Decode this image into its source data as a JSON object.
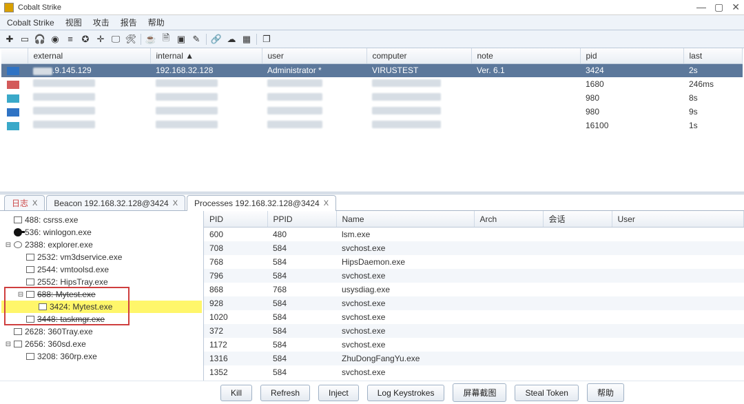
{
  "app_title": "Cobalt Strike",
  "menu": [
    "Cobalt Strike",
    "视图",
    "攻击",
    "报告",
    "帮助"
  ],
  "toolbar_icons": [
    "plus-box-icon",
    "minus-box-icon",
    "headphones-icon",
    "radar-icon",
    "list-lines-icon",
    "target-icon",
    "crosshair-icon",
    "monitor-icon",
    "tools-icon",
    "sep",
    "coffee-icon",
    "document-icon",
    "save-icon",
    "pen-icon",
    "sep",
    "link-icon",
    "cloud-icon",
    "grid-icon",
    "sep",
    "cube-icon"
  ],
  "columns": {
    "external": "external",
    "internal": "internal ▲",
    "user": "user",
    "computer": "computer",
    "note": "note",
    "pid": "pid",
    "last": "last"
  },
  "beacons": [
    {
      "icon": "var1",
      "external": ".9.145.129",
      "internal": "192.168.32.128",
      "user": "Administrator *",
      "computer": "VIRUSTEST",
      "note": "Ver. 6.1",
      "pid": "3424",
      "last": "2s",
      "selected": true,
      "ext_blur_w": 28
    },
    {
      "icon": "var2",
      "pid": "1680",
      "last": "246ms",
      "blur": true
    },
    {
      "icon": "var3",
      "pid": "980",
      "last": "8s",
      "blur": true
    },
    {
      "icon": "var1",
      "pid": "980",
      "last": "9s",
      "blur": true
    },
    {
      "icon": "var3",
      "pid": "16100",
      "last": "1s",
      "blur": true
    }
  ],
  "tabs": [
    {
      "label": "日志",
      "red": true,
      "close": "X"
    },
    {
      "label": "Beacon 192.168.32.128@3424",
      "close": "X"
    },
    {
      "label": "Processes 192.168.32.128@3424",
      "close": "X",
      "active": true
    }
  ],
  "tree": [
    {
      "indent": 0,
      "tw": "",
      "icon": "box",
      "label": "488: csrss.exe"
    },
    {
      "indent": 0,
      "tw": "",
      "icon": "key",
      "label": "536: winlogon.exe"
    },
    {
      "indent": 0,
      "tw": "⊟",
      "icon": "globe",
      "label": "2388: explorer.exe"
    },
    {
      "indent": 1,
      "tw": "",
      "icon": "box",
      "label": "2532: vm3dservice.exe"
    },
    {
      "indent": 1,
      "tw": "",
      "icon": "box",
      "label": "2544: vmtoolsd.exe"
    },
    {
      "indent": 1,
      "tw": "",
      "icon": "box",
      "label": "2552: HipsTray.exe"
    },
    {
      "indent": 1,
      "tw": "⊟",
      "icon": "box",
      "label": "688: Mytest.exe",
      "strike": true
    },
    {
      "indent": 2,
      "tw": "",
      "icon": "box",
      "label": "3424: Mytest.exe",
      "yellow": true
    },
    {
      "indent": 1,
      "tw": "",
      "icon": "box",
      "label": "3448: taskmgr.exe",
      "strike": true
    },
    {
      "indent": 0,
      "tw": "",
      "icon": "box",
      "label": "2628: 360Tray.exe"
    },
    {
      "indent": 0,
      "tw": "⊟",
      "icon": "box",
      "label": "2656: 360sd.exe"
    },
    {
      "indent": 1,
      "tw": "",
      "icon": "box",
      "label": "3208: 360rp.exe"
    }
  ],
  "proc_columns": {
    "pid": "PID",
    "ppid": "PPID",
    "name": "Name",
    "arch": "Arch",
    "session": "会话",
    "user": "User"
  },
  "processes": [
    {
      "pid": "600",
      "ppid": "480",
      "name": "lsm.exe"
    },
    {
      "pid": "708",
      "ppid": "584",
      "name": "svchost.exe"
    },
    {
      "pid": "768",
      "ppid": "584",
      "name": "HipsDaemon.exe"
    },
    {
      "pid": "796",
      "ppid": "584",
      "name": "svchost.exe"
    },
    {
      "pid": "868",
      "ppid": "768",
      "name": "usysdiag.exe"
    },
    {
      "pid": "928",
      "ppid": "584",
      "name": "svchost.exe"
    },
    {
      "pid": "1020",
      "ppid": "584",
      "name": "svchost.exe"
    },
    {
      "pid": "372",
      "ppid": "584",
      "name": "svchost.exe"
    },
    {
      "pid": "1172",
      "ppid": "584",
      "name": "svchost.exe"
    },
    {
      "pid": "1316",
      "ppid": "584",
      "name": "ZhuDongFangYu.exe"
    },
    {
      "pid": "1352",
      "ppid": "584",
      "name": "svchost.exe"
    }
  ],
  "buttons": [
    "Kill",
    "Refresh",
    "Inject",
    "Log Keystrokes",
    "屏幕截图",
    "Steal Token",
    "帮助"
  ],
  "window_controls": {
    "min": "—",
    "max": "▢",
    "close": "✕"
  }
}
